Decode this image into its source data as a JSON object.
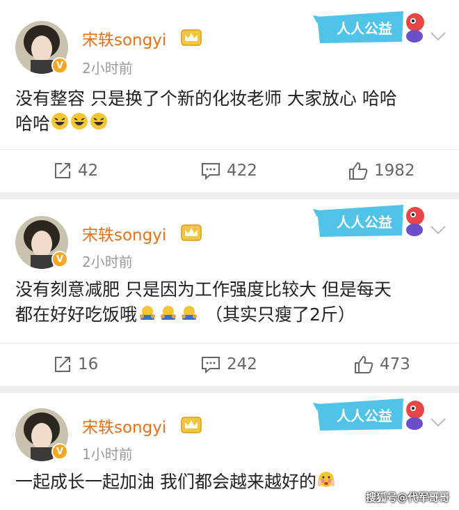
{
  "posts": [
    {
      "username": "宋轶songyi",
      "time": "2小时前",
      "badge_text": "人人公益",
      "content_lines": [
        "没有整容 只是换了个新的化妆老师 大家放心 哈哈",
        "哈哈"
      ],
      "content_tail": "",
      "emoji": "laughing-emoji",
      "reposts": "42",
      "comments": "422",
      "likes": "1982"
    },
    {
      "username": "宋轶songyi",
      "time": "2小时前",
      "badge_text": "人人公益",
      "content_lines": [
        "没有刻意减肥 只是因为工作强度比较大 但是每天",
        "都在好好吃饭哦"
      ],
      "content_tail": "（其实只瘦了2斤）",
      "emoji": "hungry-emoji",
      "reposts": "16",
      "comments": "242",
      "likes": "473"
    },
    {
      "username": "宋轶songyi",
      "time": "1小时前",
      "badge_text": "人人公益",
      "content_lines": [
        "一起成长一起加油 我们都会越来越好的"
      ],
      "content_tail": "",
      "emoji": "shy-emoji"
    }
  ],
  "verified_badge": "V",
  "watermark": "搜狐号@代军哥哥",
  "colors": {
    "username": "#e8711a",
    "verified": "#f5a623",
    "badge_bg": "#4fc3e8"
  }
}
